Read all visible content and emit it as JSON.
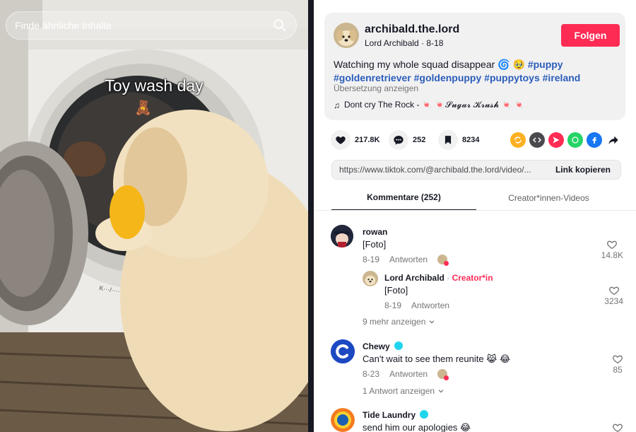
{
  "video": {
    "search_placeholder": "Finde ähnliche Inhalte",
    "caption": "Toy wash day",
    "teddy_emoji": "🧸"
  },
  "post": {
    "username": "archibald.the.lord",
    "display_name": "Lord Archibald",
    "date": "8-18",
    "follow_label": "Folgen",
    "description_text": "Watching my whole squad disappear 🌀 🥹 ",
    "hashtags": [
      "#puppy",
      "#goldenretriever",
      "#goldenpuppy",
      "#puppytoys",
      "#ireland"
    ],
    "translate_label": "Übersetzung anzeigen",
    "music_note": "♫",
    "music_title": "Dont cry The Rock - 🍬 🍬𝓢𝓾𝓰𝓪𝓻 𝓚𝓻𝓾𝓼𝓱 🍬 🍬"
  },
  "actions": {
    "likes": "217.8K",
    "comments": "252",
    "saves": "8234"
  },
  "link": {
    "url": "https://www.tiktok.com/@archibald.the.lord/video/...",
    "copy_label": "Link kopieren"
  },
  "tabs": {
    "comments": "Kommentare (252)",
    "creator_videos": "Creator*innen-Videos"
  },
  "comments": [
    {
      "name": "rowan",
      "text": "[Foto]",
      "date": "8-19",
      "reply_label": "Antworten",
      "likes": "14.8K"
    },
    {
      "name": "Lord Archibald",
      "badge": "Creator*in",
      "text": "[Foto]",
      "date": "8-19",
      "reply_label": "Antworten",
      "likes": "3234"
    },
    {
      "more_label": "9 mehr anzeigen"
    },
    {
      "name": "Chewy",
      "text": "Can't wait to see them reunite 😹 😂",
      "date": "8-23",
      "reply_label": "Antworten",
      "likes": "85",
      "more_label": "1 Antwort anzeigen"
    },
    {
      "name": "Tide Laundry",
      "text": "send him our apologies 😂"
    }
  ],
  "colors": {
    "accent": "#fe2c55",
    "hashtag": "#2b5db9",
    "verified": "#20d5ec"
  }
}
